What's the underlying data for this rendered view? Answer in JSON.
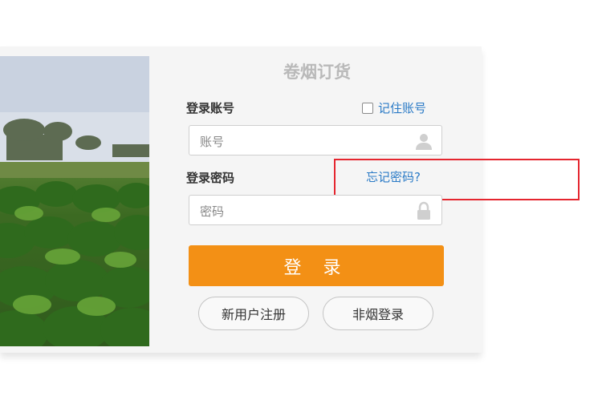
{
  "form": {
    "title": "卷烟订货",
    "account_label": "登录账号",
    "remember_label": "记住账号",
    "account_placeholder": "账号",
    "password_label": "登录密码",
    "forgot_label": "忘记密码?",
    "password_placeholder": "密码",
    "login_label": "登 录",
    "register_label": "新用户注册",
    "nontobacco_label": "非烟登录"
  },
  "colors": {
    "accent": "#f39015",
    "link": "#2a7ac6",
    "highlight": "#e5262f"
  },
  "icons": {
    "account_icon": "user-icon",
    "password_icon": "lock-icon",
    "remember_checkbox": "checkbox-unchecked"
  }
}
